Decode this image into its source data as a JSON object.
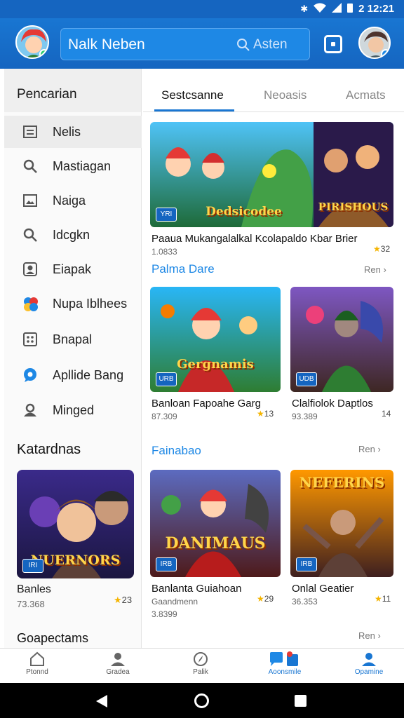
{
  "status_bar": {
    "time": "2 12:21",
    "icons": [
      "bluetooth-icon",
      "wifi-icon",
      "signal-icon",
      "battery-icon"
    ]
  },
  "app_bar": {
    "title": "Nalk Neben",
    "search_placeholder": "Asten"
  },
  "sidebar": {
    "header": "Pencarian",
    "items": [
      {
        "label": "Nelis",
        "icon": "list-icon"
      },
      {
        "label": "Mastiagan",
        "icon": "search-icon"
      },
      {
        "label": "Naiga",
        "icon": "image-icon"
      },
      {
        "label": "Idcgkn",
        "icon": "search-icon"
      },
      {
        "label": "Eiapak",
        "icon": "user-card-icon"
      },
      {
        "label": "Nupa Iblhees",
        "icon": "multicolor-apps-icon"
      },
      {
        "label": "Bnapal",
        "icon": "dice-icon"
      },
      {
        "label": "Apllide Bang",
        "icon": "location-pin-icon"
      },
      {
        "label": "Minged",
        "icon": "person-icon"
      }
    ],
    "section_title": "Katardnas",
    "card": {
      "banner": "NUERNORS",
      "tag": "IRI",
      "name": "Banles",
      "sub": "73.368",
      "rating": "23"
    },
    "bottom_section": "Goapectams"
  },
  "tabs": [
    {
      "label": "Sestcsanne",
      "active": true
    },
    {
      "label": "Neoasis",
      "active": false
    },
    {
      "label": "Acmats",
      "active": false
    }
  ],
  "featured": {
    "title": "Paaua Mukangalalkal Kcolapaldo Kbar Brier",
    "sub": "1.0833",
    "rating": "32",
    "tag": "YRI",
    "banner_left": "Dedsicodee",
    "banner_right": "PIRISHOUS"
  },
  "section1": {
    "title": "Palma Dare",
    "more": "Ren"
  },
  "row1": [
    {
      "banner": "Gergnamis",
      "tag": "URB",
      "title": "Banloan Fapoahe Garg",
      "sub": "87.309",
      "rating": "13"
    },
    {
      "banner": "",
      "tag": "UDB",
      "title": "Clalfiolok Daptlos",
      "sub": "93.389",
      "rating": "14"
    }
  ],
  "section2": {
    "title": "Fainabao",
    "more": "Ren"
  },
  "row2": [
    {
      "banner": "DANIMAUS",
      "tag": "IRB",
      "title": "Banlanta Guiahoan",
      "sub": "Gaandmenn",
      "sub2": "3.8399",
      "rating": "29"
    },
    {
      "banner": "NEFERINS",
      "tag": "IRB",
      "title": "Onlal Geatier",
      "sub": "36.353",
      "rating": "11"
    }
  ],
  "more3": "Ren",
  "bottom_nav": [
    {
      "label": "Ptonnd",
      "icon": "home-icon",
      "active": false
    },
    {
      "label": "Gradea",
      "icon": "profile-icon",
      "active": false
    },
    {
      "label": "Palik",
      "icon": "compass-icon",
      "active": false
    },
    {
      "label": "Aoonsmile",
      "icon": "chat-icon",
      "active": true
    },
    {
      "label": "Opamine",
      "icon": "account-icon",
      "active": true
    }
  ],
  "colors": {
    "primary": "#1976d2",
    "accent": "#1e88e5",
    "star": "#f4b400"
  }
}
